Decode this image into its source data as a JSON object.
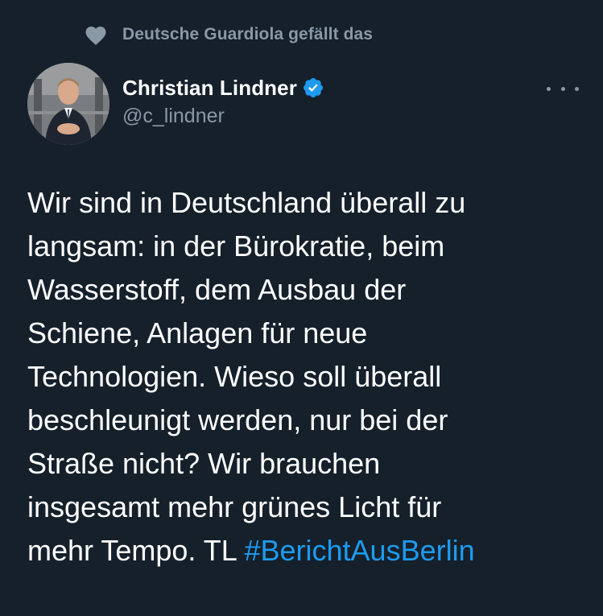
{
  "social_context": {
    "icon": "heart-icon",
    "text": "Deutsche Guardiola gefällt das"
  },
  "author": {
    "display_name": "Christian Lindner",
    "handle": "@c_lindner",
    "verified_icon": "verified-badge-icon",
    "avatar": "avatar"
  },
  "more_icon": "more-options-icon",
  "tweet": {
    "lines": [
      "Wir sind in Deutschland überall zu",
      "langsam: in der Bürokratie, beim",
      "Wasserstoff, dem Ausbau der",
      "Schiene, Anlagen für neue",
      "Technologien. Wieso soll überall",
      "beschleunigt werden, nur bei der",
      "Straße nicht? Wir brauchen",
      "insgesamt mehr grünes Licht für"
    ],
    "last_line_prefix": "mehr Tempo. TL ",
    "hashtag": "#BerichtAusBerlin"
  },
  "colors": {
    "background": "#15202b",
    "text_primary": "#ffffff",
    "text_secondary": "#8b98a5",
    "accent": "#1d9bf0"
  }
}
